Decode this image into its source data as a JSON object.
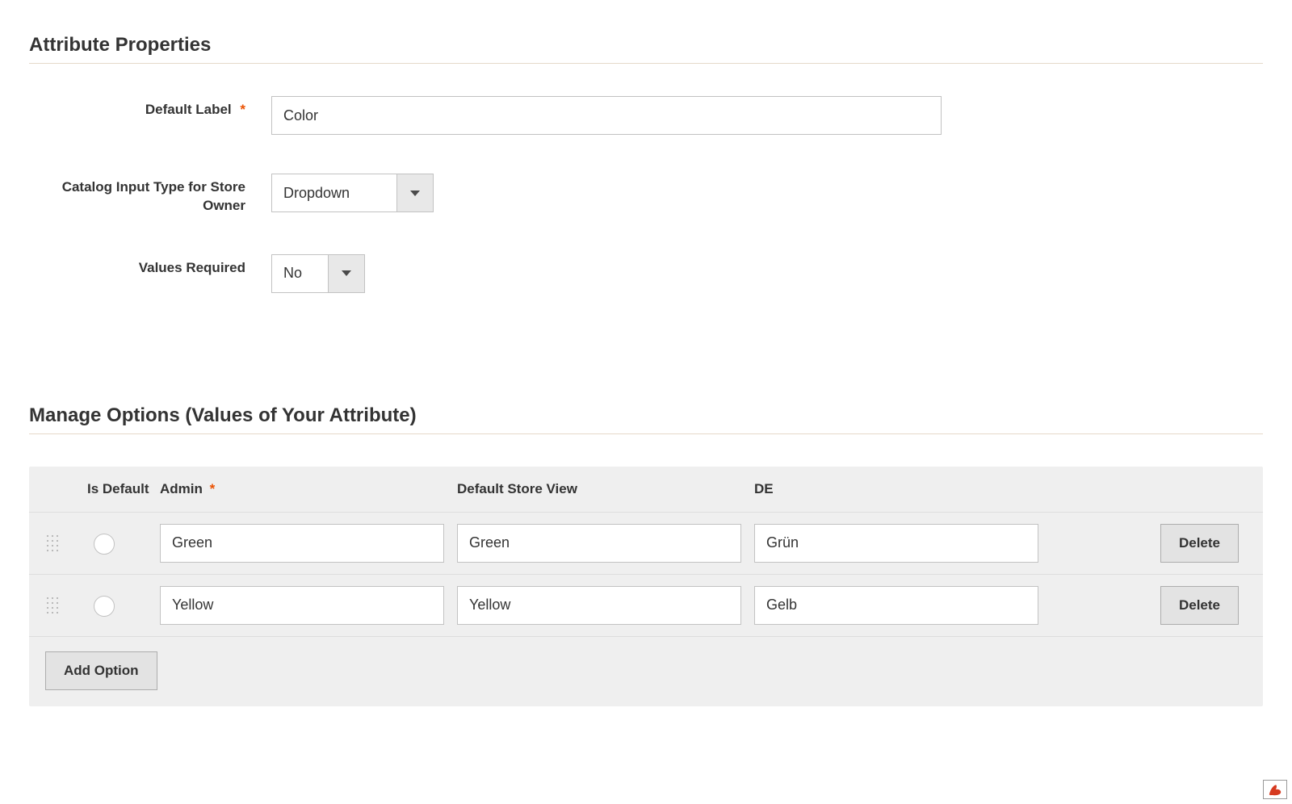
{
  "sections": {
    "attribute_properties_title": "Attribute Properties",
    "manage_options_title": "Manage Options (Values of Your Attribute)"
  },
  "labels": {
    "default_label": "Default Label",
    "catalog_input_type": "Catalog Input Type for Store Owner",
    "values_required": "Values Required"
  },
  "values": {
    "default_label": "Color",
    "catalog_input_type": "Dropdown",
    "values_required": "No"
  },
  "options": {
    "columns": {
      "is_default": "Is Default",
      "admin": "Admin",
      "default_store_view": "Default Store View",
      "de": "DE"
    },
    "rows": [
      {
        "admin": "Green",
        "default_store_view": "Green",
        "de": "Grün",
        "is_default": false
      },
      {
        "admin": "Yellow",
        "default_store_view": "Yellow",
        "de": "Gelb",
        "is_default": false
      }
    ],
    "buttons": {
      "delete": "Delete",
      "add_option": "Add Option"
    }
  },
  "required_marker": "*"
}
